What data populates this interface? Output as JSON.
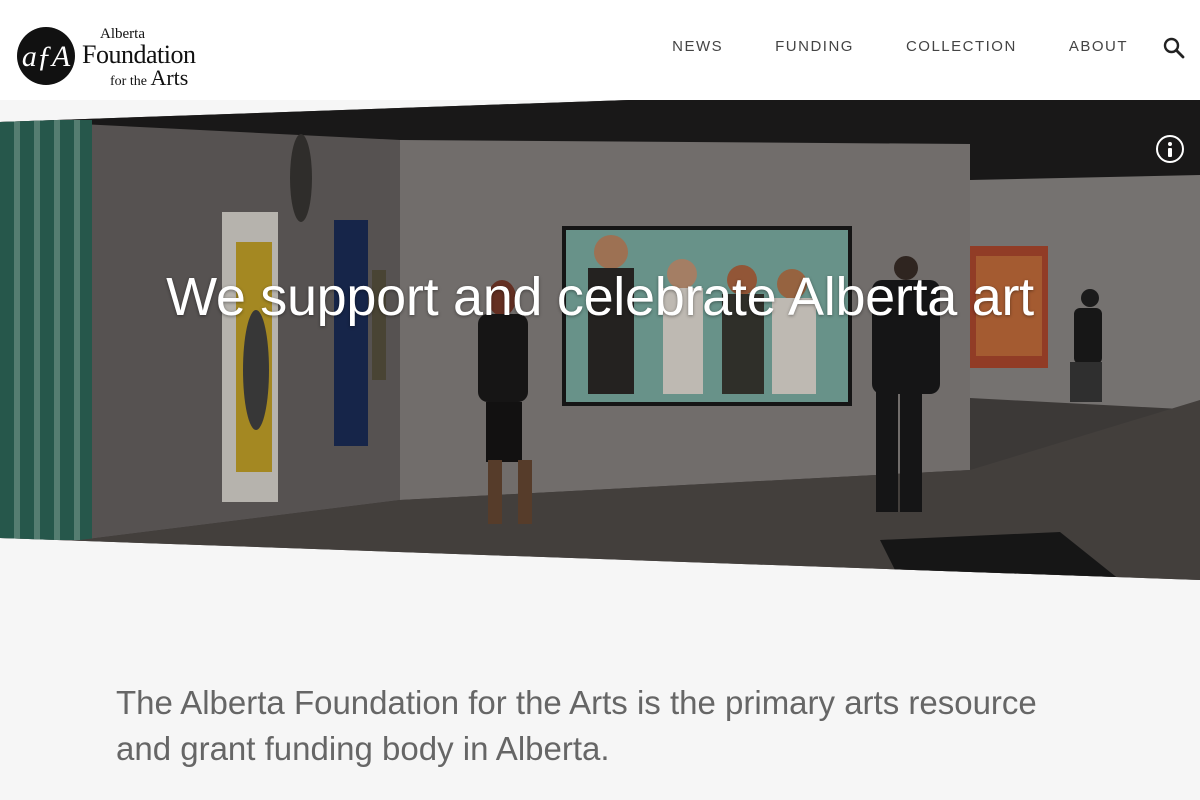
{
  "logo": {
    "monogram": "afA",
    "line1": "Alberta",
    "line2": "Foundation",
    "line3_prefix": "for the",
    "line3_word": "Arts"
  },
  "nav": {
    "items": [
      {
        "label": "NEWS"
      },
      {
        "label": "FUNDING"
      },
      {
        "label": "COLLECTION"
      },
      {
        "label": "ABOUT"
      }
    ],
    "search_icon": "search-icon"
  },
  "hero": {
    "title": "We support and celebrate Alberta art",
    "info_icon": "info-icon"
  },
  "intro": {
    "text": "The Alberta Foundation for the Arts is the primary arts resource and grant funding body in Alberta."
  },
  "colors": {
    "header_bg": "#ffffff",
    "page_bg": "#f6f6f6",
    "nav_text": "#444444",
    "intro_text": "#666666"
  }
}
